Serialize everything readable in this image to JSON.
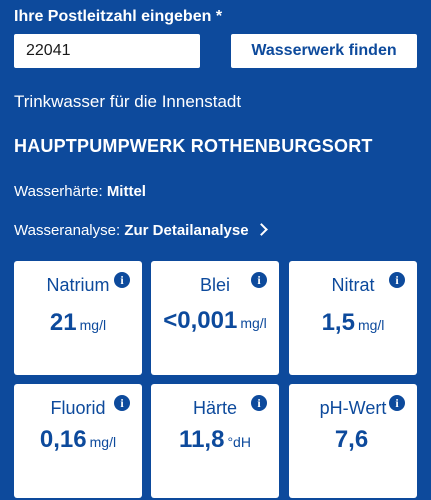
{
  "zip": {
    "label": "Ihre Postleitzahl eingeben *",
    "value": "22041",
    "button_label": "Wasserwerk finden"
  },
  "result": {
    "subtitle": "Trinkwasser für die Innenstadt",
    "plant_name": "HAUPTPUMPWERK ROTHENBURGSORT",
    "hardness_label": "Wasserhärte: ",
    "hardness_value": "Mittel",
    "analysis_label": "Wasseranalyse: ",
    "analysis_link": "Zur Detailanalyse"
  },
  "cards": [
    {
      "title": "Natrium",
      "value": "21",
      "unit": "mg/l"
    },
    {
      "title": "Blei",
      "value": "<0,001",
      "unit": "mg/l"
    },
    {
      "title": "Nitrat",
      "value": "1,5",
      "unit": "mg/l"
    },
    {
      "title": "Fluorid",
      "value": "0,16",
      "unit": "mg/l"
    },
    {
      "title": "Härte",
      "value": "11,8",
      "unit": "°dH"
    },
    {
      "title": "pH-Wert",
      "value": "7,6",
      "unit": ""
    }
  ],
  "icons": {
    "info": "info-icon",
    "chevron": "chevron-right-icon"
  },
  "colors": {
    "background": "#0D4A9C",
    "card": "#ffffff",
    "text_on_card": "#0D4A9C"
  }
}
